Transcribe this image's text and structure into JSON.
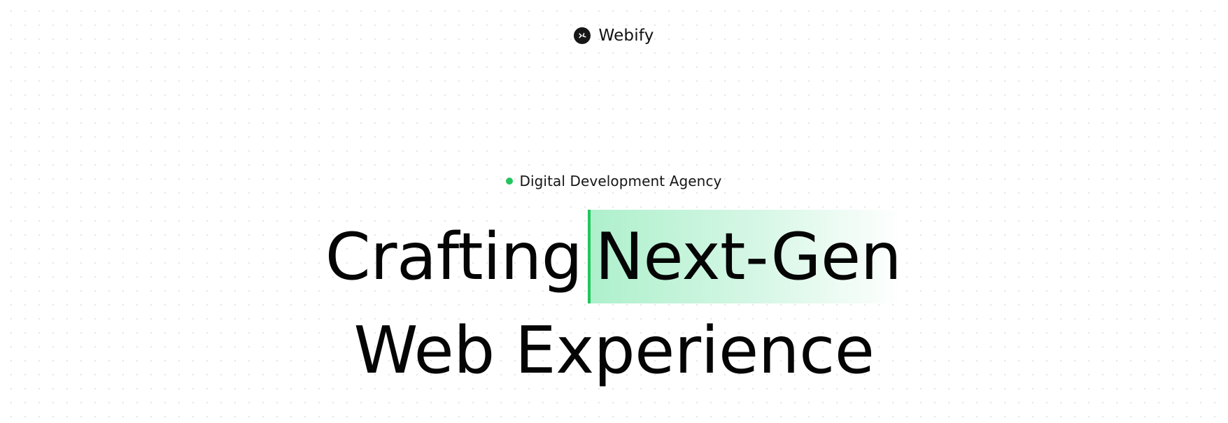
{
  "brand": {
    "name": "Webify",
    "logo_icon": "brand-x-icon"
  },
  "hero": {
    "eyebrow": "Digital Development Agency",
    "headline_part1": "Crafting",
    "headline_highlight": "Next-Gen",
    "headline_line2": "Web Experience"
  },
  "colors": {
    "accent": "#22c55e",
    "highlight": "#bdf3d6",
    "text": "#050505",
    "logo_bg": "#161616"
  }
}
